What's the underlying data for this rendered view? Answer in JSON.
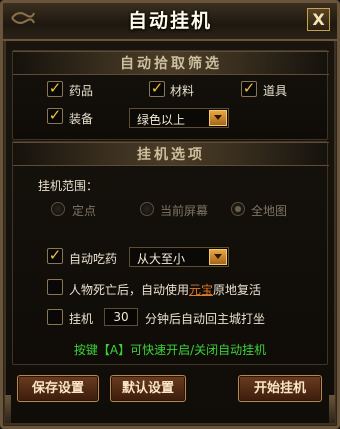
{
  "window": {
    "title": "自动挂机",
    "close_label": "X"
  },
  "pickup": {
    "header": "自动拾取筛选",
    "items": [
      {
        "label": "药品",
        "checked": true
      },
      {
        "label": "材料",
        "checked": true
      },
      {
        "label": "道具",
        "checked": true
      }
    ],
    "equip": {
      "label": "装备",
      "checked": true,
      "dropdown_value": "绿色以上"
    }
  },
  "options": {
    "header": "挂机选项",
    "range_label": "挂机范围：",
    "range_options": [
      {
        "label": "定点",
        "selected": false
      },
      {
        "label": "当前屏幕",
        "selected": false
      },
      {
        "label": "全地图",
        "selected": true
      }
    ],
    "auto_potion": {
      "label": "自动吃药",
      "checked": true,
      "dropdown_value": "从大至小"
    },
    "revive": {
      "prefix": "人物死亡后，自动使用",
      "highlight": "元宝",
      "suffix": "原地复活",
      "checked": false
    },
    "return_city": {
      "label": "挂机",
      "minutes": "30",
      "suffix": "分钟后自动回主城打坐",
      "checked": false
    }
  },
  "hint": "按键【A】可快速开启/关闭自动挂机",
  "buttons": {
    "save": "保存设置",
    "default": "默认设置",
    "start": "开始挂机"
  },
  "colors": {
    "check": "#f3c12e",
    "hint": "#3bd13b",
    "highlight": "#e07a2a"
  },
  "icons": {
    "check": "check-icon",
    "dropdown": "chevron-down-icon",
    "close": "close-icon"
  }
}
